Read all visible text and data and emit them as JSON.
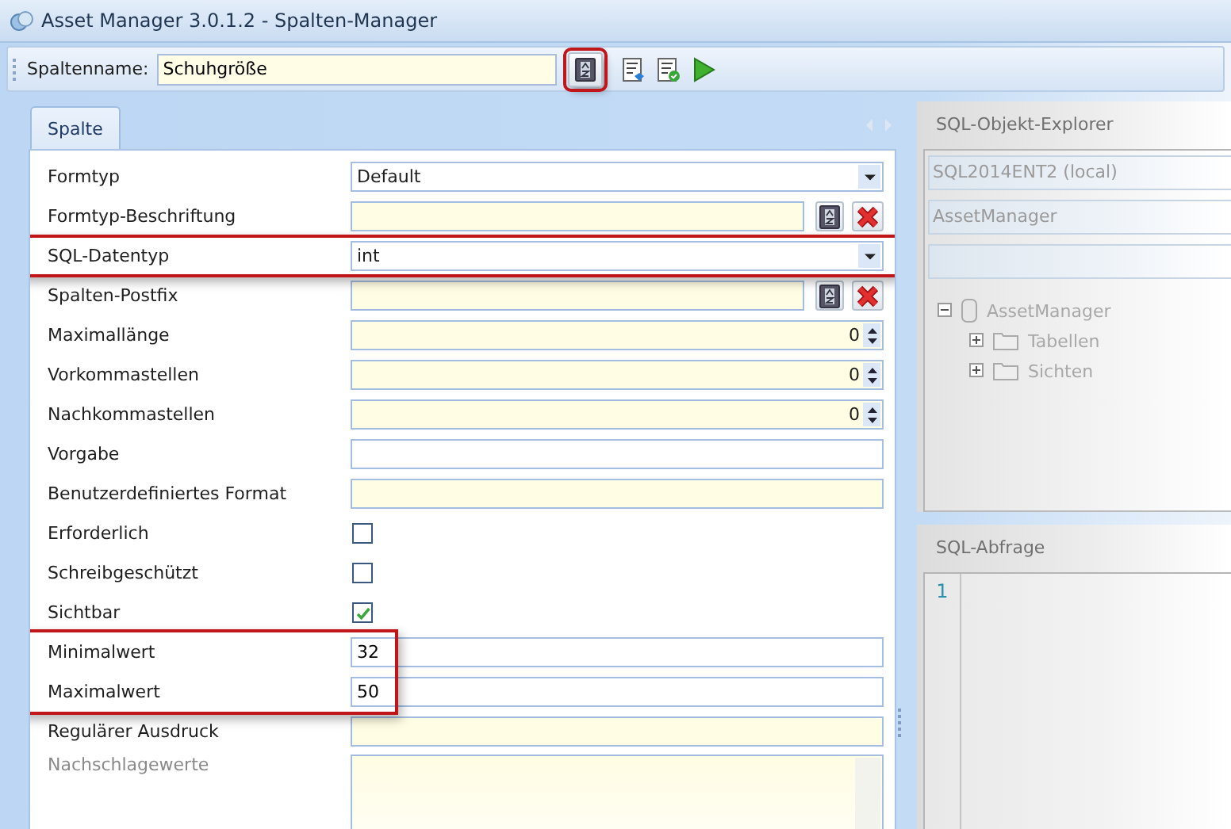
{
  "window": {
    "title": "Asset Manager 3.0.1.2 - Spalten-Manager"
  },
  "toolbar": {
    "label": "Spaltenname:",
    "value": "Schuhgröße",
    "highlight_button": true
  },
  "tabs": [
    {
      "label": "Spalte",
      "selected": true
    }
  ],
  "fields": [
    {
      "label": "Formtyp",
      "kind": "dropdown",
      "value": "Default",
      "required": false,
      "highlighted": false,
      "disabled": false
    },
    {
      "label": "Formtyp-Beschriftung",
      "kind": "text-buttons",
      "required": true,
      "highlighted": false,
      "disabled": false
    },
    {
      "label": "SQL-Datentyp",
      "kind": "dropdown",
      "value": "int",
      "required": false,
      "highlighted": true,
      "disabled": false
    },
    {
      "label": "Spalten-Postfix",
      "kind": "text-buttons",
      "required": true,
      "highlighted": false,
      "disabled": false
    },
    {
      "label": "Maximallänge",
      "kind": "number",
      "value": "0",
      "required": true,
      "highlighted": false,
      "disabled": false
    },
    {
      "label": "Vorkommastellen",
      "kind": "number",
      "value": "0",
      "required": true,
      "highlighted": false,
      "disabled": false
    },
    {
      "label": "Nachkommastellen",
      "kind": "number",
      "value": "0",
      "required": true,
      "highlighted": false,
      "disabled": false
    },
    {
      "label": "Vorgabe",
      "kind": "text",
      "required": false,
      "highlighted": false,
      "disabled": false
    },
    {
      "label": "Benutzerdefiniertes Format",
      "kind": "text",
      "required": true,
      "highlighted": false,
      "disabled": false
    },
    {
      "label": "Erforderlich",
      "kind": "checkbox",
      "checked": false,
      "highlighted": false,
      "disabled": false
    },
    {
      "label": "Schreibgeschützt",
      "kind": "checkbox",
      "checked": false,
      "highlighted": false,
      "disabled": false
    },
    {
      "label": "Sichtbar",
      "kind": "checkbox",
      "checked": true,
      "highlighted": false,
      "disabled": false
    },
    {
      "label": "Minimalwert",
      "kind": "text",
      "value": "32",
      "required": false,
      "highlighted": true,
      "disabled": false
    },
    {
      "label": "Maximalwert",
      "kind": "text",
      "value": "50",
      "required": false,
      "highlighted": true,
      "disabled": false
    },
    {
      "label": "Regulärer Ausdruck",
      "kind": "text",
      "required": true,
      "highlighted": false,
      "disabled": false
    },
    {
      "label": "Nachschlagewerte",
      "kind": "memo",
      "required": true,
      "highlighted": false,
      "disabled": true
    }
  ],
  "explorer": {
    "title": "SQL-Objekt-Explorer",
    "server": "SQL2014ENT2 (local)",
    "database": "AssetManager",
    "tree": [
      {
        "label": "AssetManager",
        "kind": "database",
        "expanded": true,
        "children": [
          {
            "label": "Tabellen",
            "kind": "folder",
            "expanded": false
          },
          {
            "label": "Sichten",
            "kind": "folder",
            "expanded": false
          }
        ]
      }
    ]
  },
  "query": {
    "title": "SQL-Abfrage",
    "line_numbers": [
      "1"
    ]
  }
}
